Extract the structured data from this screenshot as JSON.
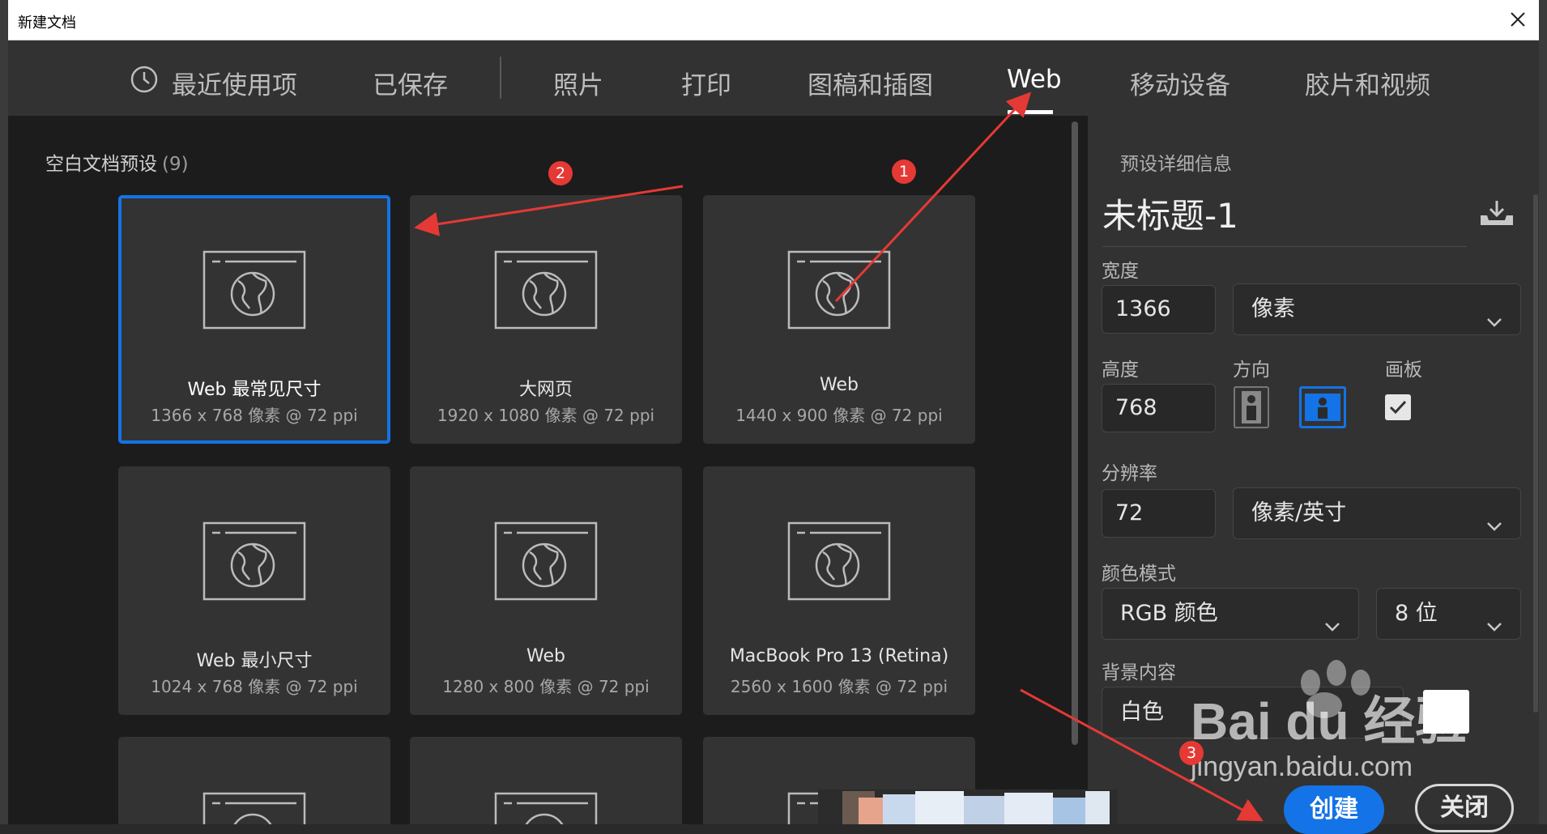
{
  "window": {
    "title": "新建文档"
  },
  "tabs": [
    {
      "label": "最近使用项",
      "icon": "clock-icon"
    },
    {
      "label": "已保存"
    },
    {
      "label": "照片"
    },
    {
      "label": "打印"
    },
    {
      "label": "图稿和插图"
    },
    {
      "label": "Web",
      "active": true
    },
    {
      "label": "移动设备"
    },
    {
      "label": "胶片和视频"
    }
  ],
  "presets": {
    "title": "空白文档预设",
    "count": "(9)",
    "items": [
      {
        "name": "Web 最常见尺寸",
        "size": "1366 x 768 像素 @ 72 ppi",
        "selected": true,
        "icon": "web-globe-icon"
      },
      {
        "name": "大网页",
        "size": "1920 x 1080 像素 @ 72 ppi",
        "icon": "web-globe-icon"
      },
      {
        "name": "Web",
        "size": "1440 x 900 像素 @ 72 ppi",
        "icon": "web-globe-icon"
      },
      {
        "name": "Web 最小尺寸",
        "size": "1024 x 768 像素 @ 72 ppi",
        "icon": "web-globe-icon"
      },
      {
        "name": "Web",
        "size": "1280 x 800 像素 @ 72 ppi",
        "icon": "web-globe-icon"
      },
      {
        "name": "MacBook Pro 13 (Retina)",
        "size": "2560 x 1600 像素 @ 72 ppi",
        "icon": "web-globe-icon"
      }
    ]
  },
  "details": {
    "title": "预设详细信息",
    "doc_name": "未标题-1",
    "width_label": "宽度",
    "width_value": "1366",
    "unit": "像素",
    "height_label": "高度",
    "height_value": "768",
    "orientation_label": "方向",
    "artboard_label": "画板",
    "artboard_checked": true,
    "resolution_label": "分辨率",
    "resolution_value": "72",
    "resolution_unit": "像素/英寸",
    "color_mode_label": "颜色模式",
    "color_mode": "RGB 颜色",
    "bit_depth": "8 位",
    "background_label": "背景内容",
    "background_value": "白色"
  },
  "actions": {
    "create": "创建",
    "close": "关闭"
  },
  "annotations": {
    "badge1": "1",
    "badge2": "2",
    "badge3": "3"
  },
  "watermark": {
    "brand": "Bai du 经验",
    "url": "jingyan.baidu.com"
  },
  "colors": {
    "accent": "#1473e6",
    "annotation": "#e53935",
    "panel": "#323232",
    "background": "#1c1c1c"
  }
}
